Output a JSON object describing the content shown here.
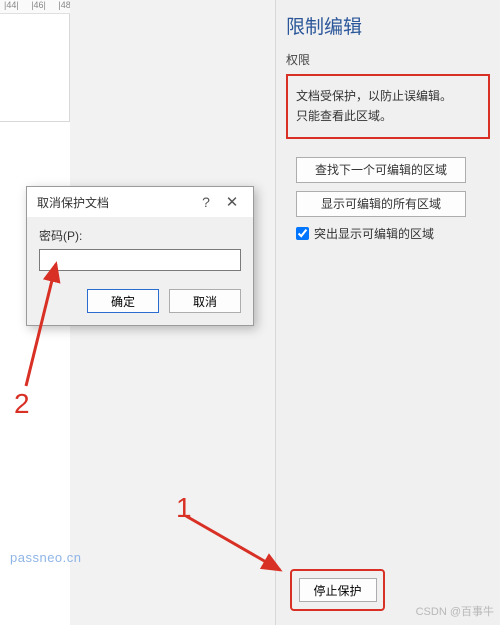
{
  "ruler": {
    "marks": [
      "|44|",
      "|46|",
      "|48"
    ]
  },
  "pane": {
    "title": "限制编辑",
    "subhead": "权限",
    "info_line1": "文档受保护，以防止误编辑。",
    "info_line2": "只能查看此区域。",
    "btn_find_next": "查找下一个可编辑的区域",
    "btn_show_all": "显示可编辑的所有区域",
    "checkbox_label": "突出显示可编辑的区域",
    "stop_protect": "停止保护"
  },
  "dialog": {
    "title": "取消保护文档",
    "help": "?",
    "close": "✕",
    "password_label": "密码(P):",
    "password_value": "",
    "ok": "确定",
    "cancel": "取消"
  },
  "annotations": {
    "num1": "1",
    "num2": "2"
  },
  "watermark": {
    "left": "passneo.cn",
    "right": "CSDN @百事牛"
  }
}
